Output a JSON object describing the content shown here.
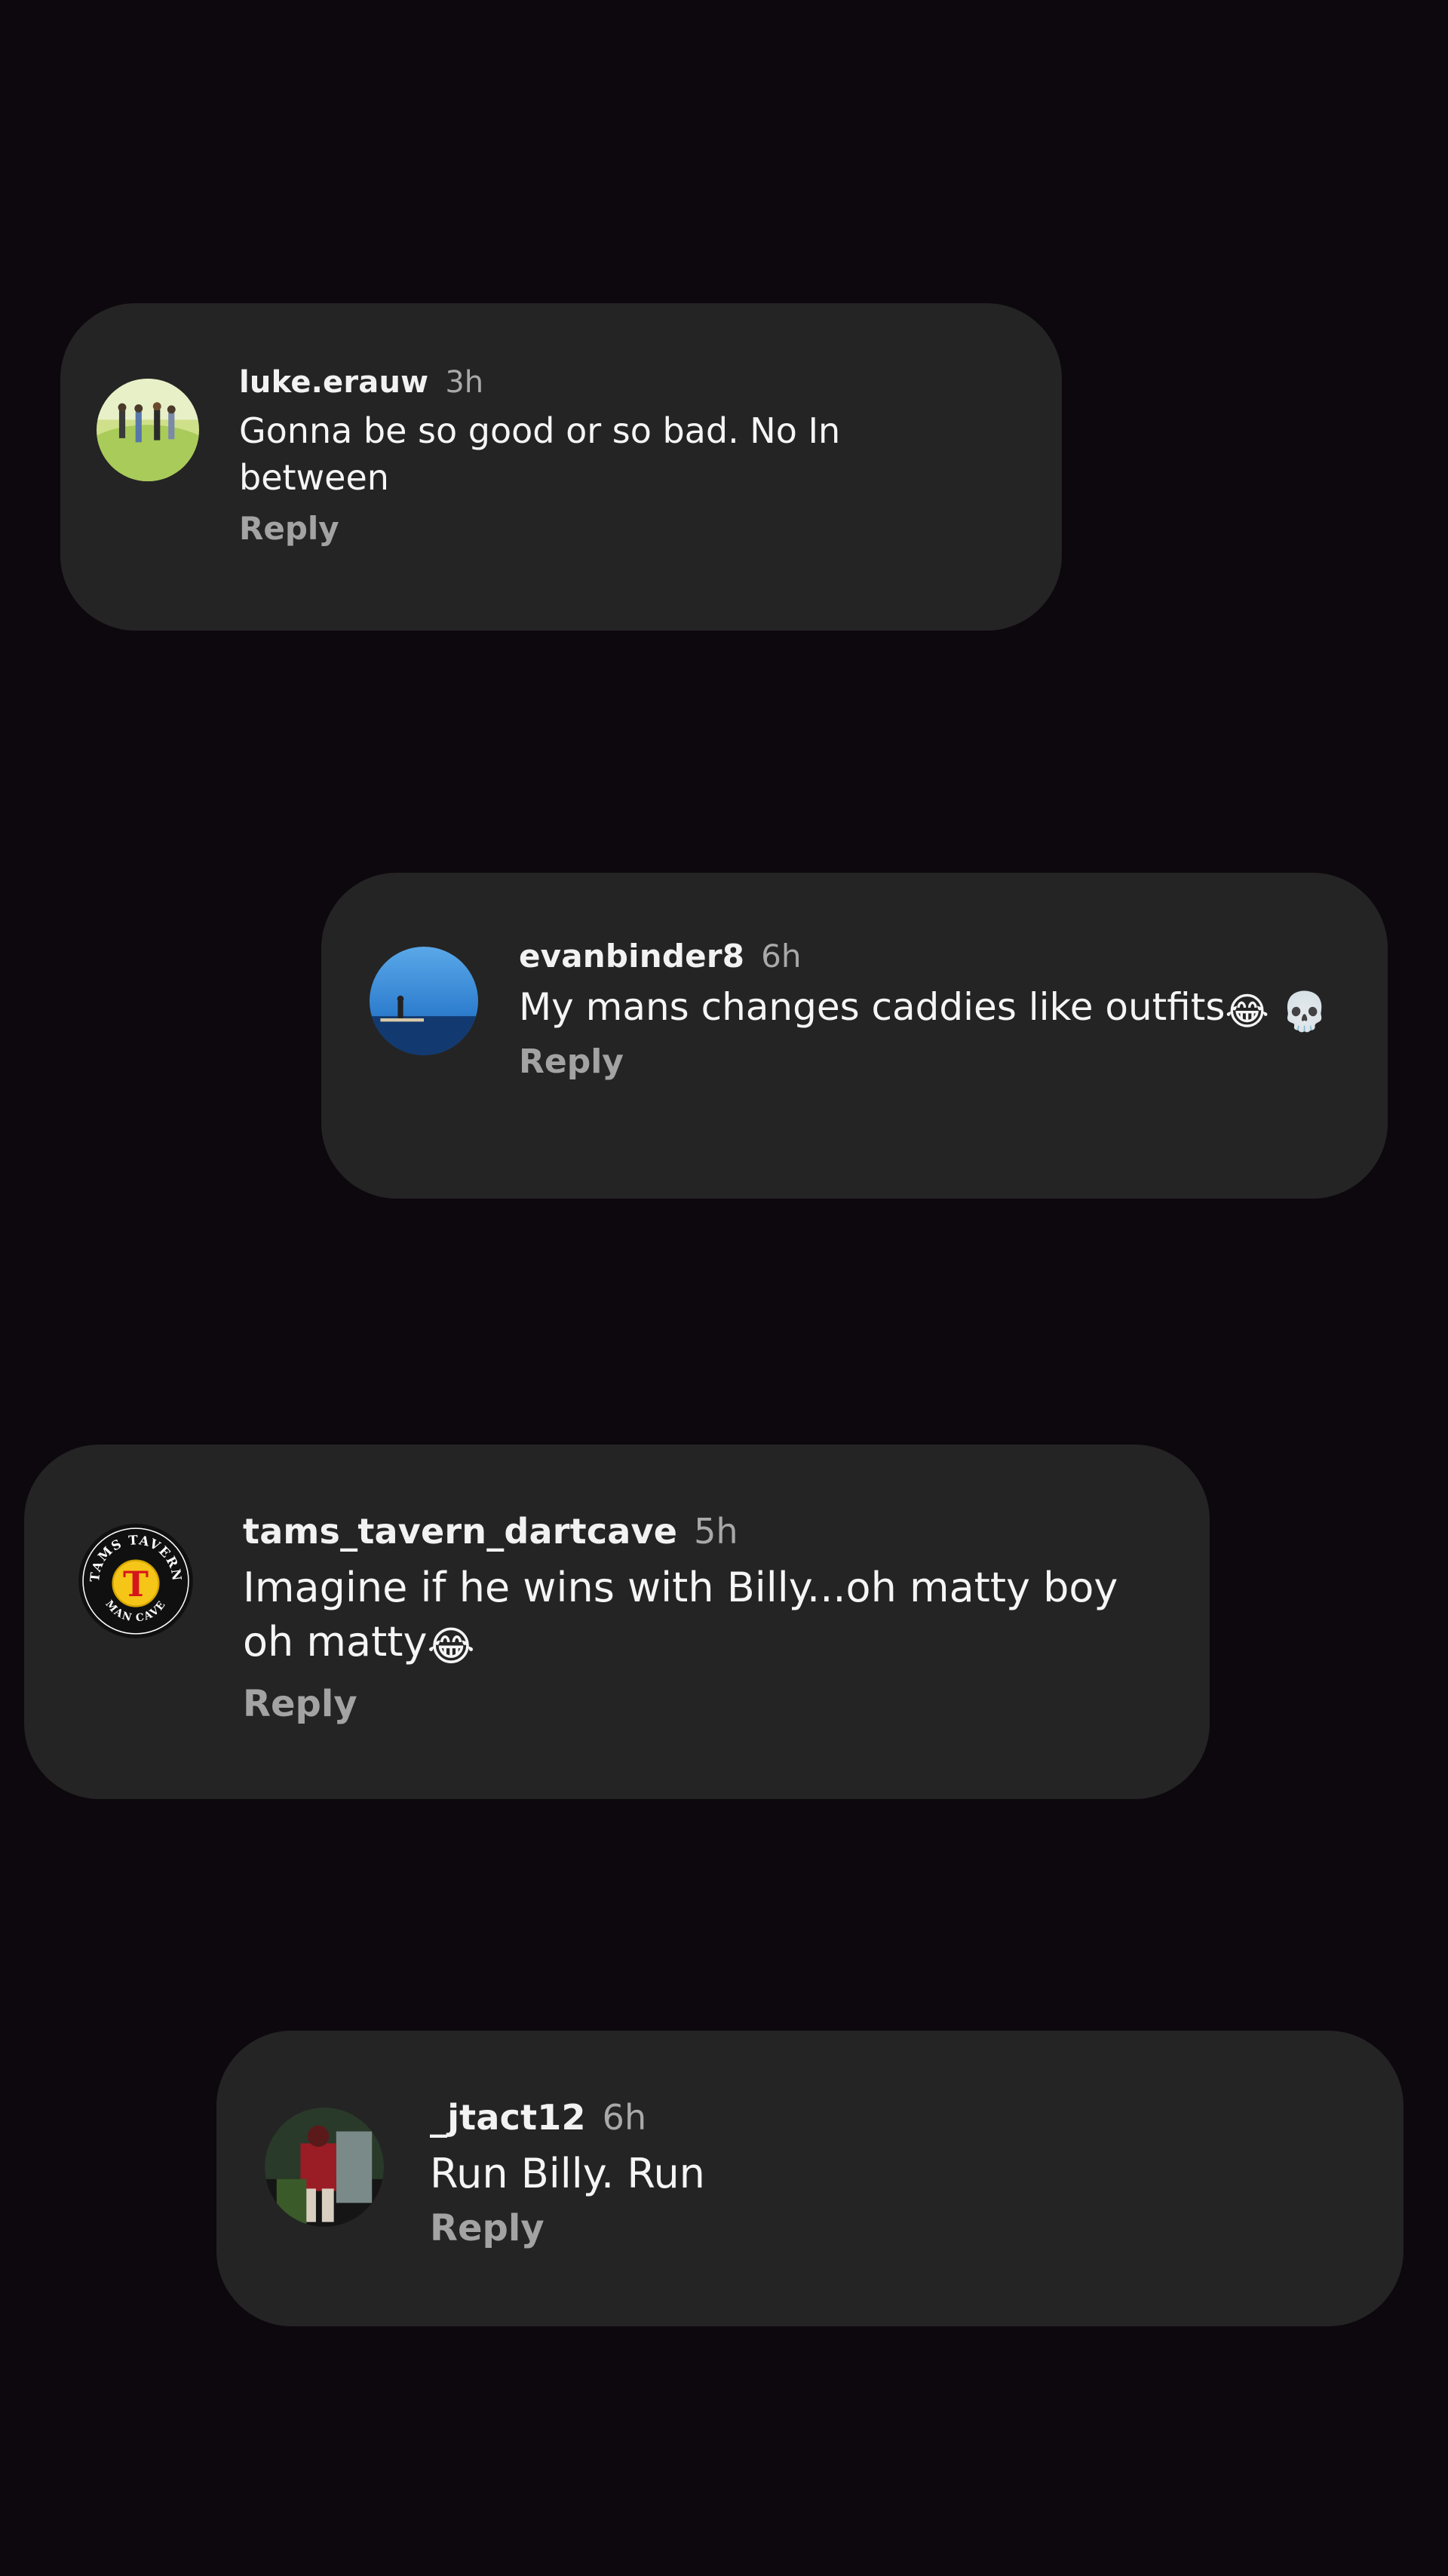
{
  "comments": [
    {
      "username": "luke.erauw",
      "time": "3h",
      "text": "Gonna be so good or so bad. No In between",
      "emoji_suffix": "",
      "reply_label": "Reply",
      "avatar_icon": "golf-course-photo-avatar"
    },
    {
      "username": "evanbinder8",
      "time": "6h",
      "text": "My mans changes caddies like outfits",
      "emoji_suffix": "😂 💀",
      "reply_label": "Reply",
      "avatar_icon": "ocean-sky-photo-avatar"
    },
    {
      "username": "tams_tavern_dartcave",
      "time": "5h",
      "text": "Imagine if he wins with Billy...oh matty boy oh matty",
      "emoji_suffix": "😂",
      "reply_label": "Reply",
      "avatar_icon": "tams-tavern-logo-avatar",
      "avatar_logo_text": {
        "top": "TAMS TAVERN",
        "center": "T",
        "bottom": "MAN CAVE"
      }
    },
    {
      "username": "_jtact12",
      "time": "6h",
      "text": "Run Billy. Run",
      "emoji_suffix": "",
      "reply_label": "Reply",
      "avatar_icon": "person-photo-avatar"
    }
  ],
  "colors": {
    "background": "#0d080d",
    "bubble": "#242424",
    "username": "#f2f2f2",
    "time": "#a9a9a9",
    "body": "#f5f5f5",
    "reply": "#a3a3a3"
  }
}
